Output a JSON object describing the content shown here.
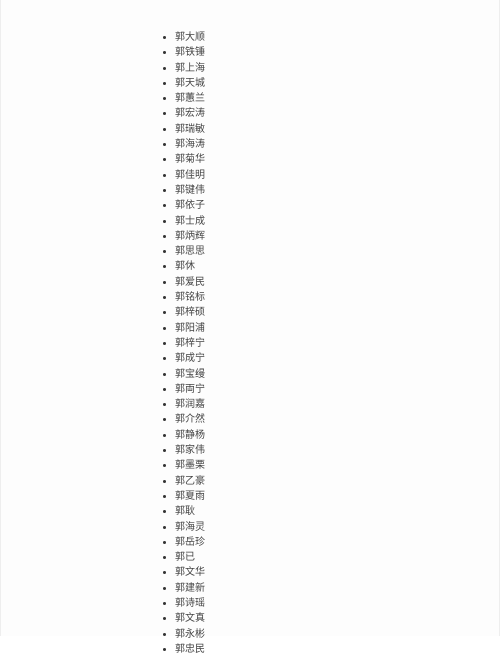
{
  "names": [
    "郭大顺",
    "郭铁锤",
    "郭上海",
    "郭天城",
    "郭蕙兰",
    "郭宏涛",
    "郭瑞敏",
    "郭海涛",
    "郭菊华",
    "郭佳明",
    "郭键伟",
    "郭依子",
    "郭士成",
    "郭炳辉",
    "郭思思",
    "郭休",
    "郭爱民",
    "郭铭标",
    "郭梓硕",
    "郭阳浦",
    "郭梓宁",
    "郭成宁",
    "郭宝缦",
    "郭両宁",
    "郭润嘉",
    "郭介然",
    "郭静杨",
    "郭家伟",
    "郭墨栗",
    "郭乙豪",
    "郭夏雨",
    "郭耿",
    "郭海灵",
    "郭岳珍",
    "郭已",
    "郭文华",
    "郭建新",
    "郭诗瑶",
    "郭文真",
    "郭永彬",
    "郭忠民"
  ]
}
